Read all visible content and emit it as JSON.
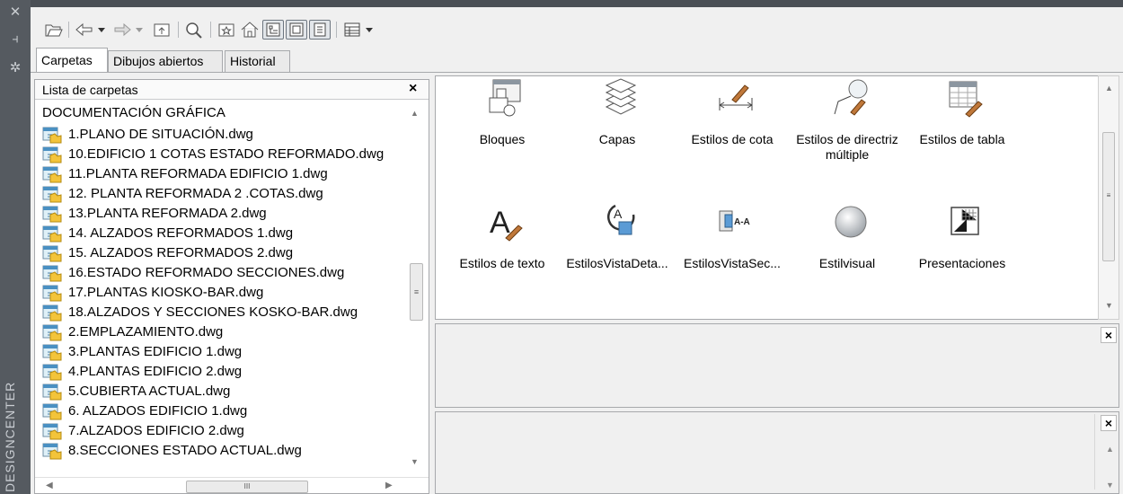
{
  "panel": {
    "vertical_title": "DESIGNCENTER"
  },
  "tabs": [
    {
      "label": "Carpetas",
      "active": true
    },
    {
      "label": "Dibujos abiertos",
      "active": false
    },
    {
      "label": "Historial",
      "active": false
    }
  ],
  "folder_list": {
    "title": "Lista de carpetas",
    "close": "×",
    "root": "DOCUMENTACIÓN GRÁFICA",
    "files": [
      "1.PLANO DE SITUACIÓN.dwg",
      "10.EDIFICIO 1 COTAS ESTADO REFORMADO.dwg",
      "11.PLANTA REFORMADA EDIFICIO 1.dwg",
      "12. PLANTA REFORMADA 2 .COTAS.dwg",
      "13.PLANTA REFORMADA 2.dwg",
      "14. ALZADOS REFORMADOS 1.dwg",
      "15. ALZADOS REFORMADOS 2.dwg",
      "16.ESTADO REFORMADO SECCIONES.dwg",
      "17.PLANTAS KIOSKO-BAR.dwg",
      "18.ALZADOS Y SECCIONES KOSKO-BAR.dwg",
      "2.EMPLAZAMIENTO.dwg",
      "3.PLANTAS EDIFICIO 1.dwg",
      "4.PLANTAS EDIFICIO 2.dwg",
      "5.CUBIERTA ACTUAL.dwg",
      "6. ALZADOS EDIFICIO 1.dwg",
      "7.ALZADOS EDIFICIO 2.dwg",
      "8.SECCIONES ESTADO ACTUAL.dwg"
    ]
  },
  "content_items": [
    {
      "label": "Bloques",
      "icon": "blocks-icon"
    },
    {
      "label": "Capas",
      "icon": "layers-icon"
    },
    {
      "label": "Estilos de cota",
      "icon": "dimstyle-icon"
    },
    {
      "label": "Estilos de directriz múltiple",
      "icon": "mleader-icon"
    },
    {
      "label": "Estilos de tabla",
      "icon": "tablestyle-icon"
    },
    {
      "label": "Estilos de texto",
      "icon": "textstyle-icon"
    },
    {
      "label": "EstilosVistaDeta...",
      "icon": "detailview-icon"
    },
    {
      "label": "EstilosVistaSec...",
      "icon": "sectionview-icon"
    },
    {
      "label": "Estilvisual",
      "icon": "visualstyle-icon"
    },
    {
      "label": "Presentaciones",
      "icon": "layout-icon"
    }
  ],
  "section_view_icon_text": "A-A",
  "detail_view_icon_text": "A",
  "text_style_icon_text": "A",
  "panes": {
    "close": "×"
  },
  "scroll_glyph": "≡",
  "hscroll_glyph": "III"
}
